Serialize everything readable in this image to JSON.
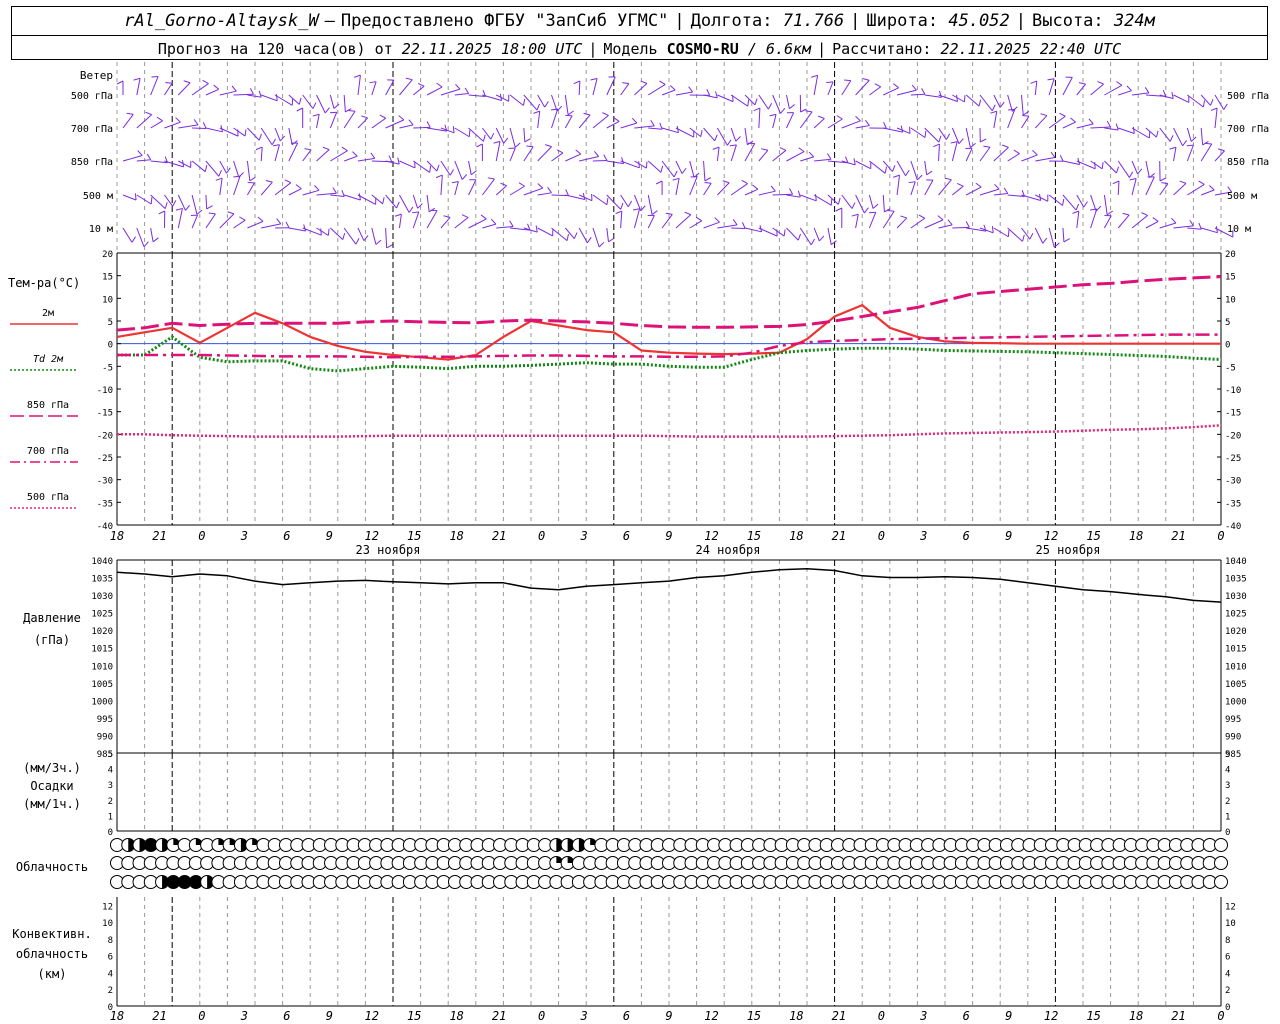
{
  "header": {
    "station": "rAl_Gorno-Altaysk_W",
    "dash": "—",
    "provided_by": "Предоставлено ФГБУ \"ЗапСиб УГМС\"",
    "lon_label": "Долгота:",
    "lon_value": "71.766",
    "lat_label": "Широта:",
    "lat_value": "45.052",
    "alt_label": "Высота:",
    "alt_value": "324м",
    "forecast_text": "Прогноз на 120 часа(ов) от",
    "forecast_time": "22.11.2025 18:00 UTC",
    "model_label": "Модель",
    "model_name": "COSMO-RU",
    "model_res": "/ 6.6км",
    "calc_label": "Рассчитано:",
    "calc_time": "22.11.2025 22:40 UTC"
  },
  "wind_panel": {
    "title": "Ветер",
    "levels": [
      "500 гПа",
      "700 гПа",
      "850 гПа",
      "500 м",
      "10  м"
    ]
  },
  "temp_panel": {
    "title": "Тем-ра(°C)",
    "legend": [
      {
        "label": "2м",
        "color": "#ee3333",
        "dash": "solid"
      },
      {
        "label": "Td  2м",
        "color": "#118811",
        "dash": "dotted"
      },
      {
        "label": "850 гПа",
        "color": "#dd1177",
        "dash": "longdash"
      },
      {
        "label": "700 гПа",
        "color": "#dd1177",
        "dash": "dashdot"
      },
      {
        "label": "500 гПа",
        "color": "#ee2277",
        "dash": "dotted"
      }
    ],
    "y_ticks": [
      "20",
      "15",
      "10",
      "5",
      "0",
      "-5",
      "-10",
      "-15",
      "-20",
      "-25",
      "-30",
      "-35",
      "-40"
    ]
  },
  "pressure_panel": {
    "title1": "Давление",
    "title2": "(гПа)",
    "y_ticks": [
      "1040",
      "1035",
      "1030",
      "1025",
      "1020",
      "1015",
      "1010",
      "1005",
      "1000",
      "995",
      "990",
      "985"
    ]
  },
  "precip_panel": {
    "title1": "(мм/3ч.)",
    "title2": "Осадки",
    "title3": "(мм/1ч.)",
    "y_ticks": [
      "5",
      "4",
      "3",
      "2",
      "1",
      "0"
    ]
  },
  "cloud_panel": {
    "title": "Облачность",
    "rows": [
      "ohhfhqoqoqqhqoooooooooooooooooooooooooohhhqoooooooooooooooooooooooooooooooooooooooooooooooooooooooo",
      "oooooooooooooooooooooooooooooooooooooooqqoooooooooooooooooooooooooooooooooooooooooooooooooooooooooo",
      "oooohfffhoooooooooooooooooooooooooooooooooooooooooooooooooooooooooooooooooooooooooooooooooooooooooo"
    ]
  },
  "convective_panel": {
    "title1": "Конвективн.",
    "title2": "облачность",
    "title3": "(км)",
    "y_ticks": [
      "12",
      "10",
      "8",
      "6",
      "4",
      "2",
      "0"
    ]
  },
  "x_axis": {
    "hour_labels": [
      "18",
      "21",
      "0",
      "3",
      "6",
      "9",
      "12",
      "15",
      "18",
      "21",
      "0",
      "3",
      "6",
      "9",
      "12",
      "15",
      "18",
      "21",
      "0",
      "3",
      "6",
      "9",
      "12",
      "15",
      "18",
      "21",
      "0"
    ],
    "date_labels": [
      "23 ноября",
      "24 ноября",
      "25 ноября"
    ]
  },
  "colors": {
    "wind": "#7a2be0",
    "t2m": "#ee3333",
    "td2m": "#118811",
    "t850": "#dd1177",
    "t700": "#dd1177",
    "t500": "#ee2277",
    "pressure": "#000000",
    "grid": "#999999"
  },
  "chart_data": {
    "type": "line",
    "x_hours_from_start": [
      0,
      3,
      6,
      9,
      12,
      15,
      18,
      21,
      24,
      27,
      30,
      33,
      36,
      39,
      42,
      45,
      48,
      51,
      54,
      57,
      60,
      63,
      66,
      69,
      72,
      75,
      78,
      81,
      84,
      87,
      90,
      93,
      96,
      99,
      102,
      105,
      108,
      111,
      114,
      117,
      120
    ],
    "x_start": "22.11.2025 18:00 UTC",
    "series": [
      {
        "name": "2м",
        "values": [
          1.5,
          2.5,
          3.5,
          0.2,
          3.5,
          6.8,
          4.5,
          1.5,
          -0.5,
          -1.8,
          -2.5,
          -3.0,
          -3.5,
          -2.5,
          1.5,
          5.0,
          4.0,
          3.0,
          2.5,
          -1.5,
          -2.0,
          -2.2,
          -2.3,
          -2.2,
          -2.0,
          1.0,
          6.0,
          8.5,
          3.5,
          1.5,
          0.5,
          0.2,
          0.1,
          0.0,
          0.0,
          0.0,
          0.0,
          0.0,
          0.0,
          0.0,
          0.0
        ]
      },
      {
        "name": "Td  2м",
        "values": [
          -2.5,
          -2.5,
          1.5,
          -3.0,
          -4.0,
          -3.8,
          -3.8,
          -5.5,
          -6.0,
          -5.5,
          -5.0,
          -5.2,
          -5.5,
          -5.0,
          -5.0,
          -4.8,
          -4.5,
          -4.2,
          -4.5,
          -4.5,
          -5.0,
          -5.2,
          -5.2,
          -3.5,
          -2.0,
          -1.5,
          -1.2,
          -1.0,
          -1.0,
          -1.2,
          -1.5,
          -1.6,
          -1.7,
          -1.8,
          -2.0,
          -2.2,
          -2.4,
          -2.6,
          -2.8,
          -3.2,
          -3.5
        ]
      },
      {
        "name": "850 гПа",
        "values": [
          3.0,
          3.5,
          4.5,
          4.0,
          4.3,
          4.5,
          4.5,
          4.5,
          4.5,
          4.8,
          5.0,
          4.8,
          4.7,
          4.6,
          5.0,
          5.2,
          5.0,
          4.8,
          4.5,
          4.0,
          3.7,
          3.6,
          3.6,
          3.7,
          3.8,
          4.2,
          5.0,
          6.0,
          7.0,
          8.0,
          9.5,
          11.0,
          11.5,
          12.0,
          12.5,
          13.0,
          13.3,
          13.8,
          14.2,
          14.5,
          14.8
        ]
      },
      {
        "name": "700 гПа",
        "values": [
          -2.5,
          -2.5,
          -2.5,
          -2.5,
          -2.6,
          -2.7,
          -2.8,
          -2.8,
          -2.8,
          -2.9,
          -3.0,
          -2.9,
          -2.9,
          -2.8,
          -2.7,
          -2.6,
          -2.6,
          -2.7,
          -2.8,
          -2.8,
          -2.9,
          -2.9,
          -2.8,
          -2.0,
          -0.5,
          0.3,
          0.6,
          0.8,
          1.0,
          1.1,
          1.2,
          1.3,
          1.4,
          1.5,
          1.6,
          1.7,
          1.8,
          1.9,
          2.0,
          2.0,
          2.0
        ]
      },
      {
        "name": "500 гПа",
        "values": [
          -20.0,
          -20.0,
          -20.2,
          -20.3,
          -20.4,
          -20.5,
          -20.5,
          -20.5,
          -20.5,
          -20.4,
          -20.3,
          -20.3,
          -20.3,
          -20.3,
          -20.3,
          -20.3,
          -20.3,
          -20.3,
          -20.3,
          -20.3,
          -20.4,
          -20.5,
          -20.5,
          -20.5,
          -20.5,
          -20.5,
          -20.4,
          -20.3,
          -20.2,
          -20.0,
          -19.8,
          -19.7,
          -19.6,
          -19.5,
          -19.4,
          -19.2,
          -19.0,
          -18.9,
          -18.7,
          -18.4,
          -18.0
        ]
      },
      {
        "name": "Давление",
        "values": [
          1036.5,
          1036.0,
          1035.2,
          1036.0,
          1035.5,
          1034.0,
          1033.0,
          1033.5,
          1034.0,
          1034.2,
          1033.8,
          1033.5,
          1033.2,
          1033.5,
          1033.5,
          1032.0,
          1031.5,
          1032.5,
          1033.0,
          1033.5,
          1034.0,
          1035.0,
          1035.5,
          1036.5,
          1037.2,
          1037.5,
          1037.0,
          1035.5,
          1035.0,
          1035.0,
          1035.2,
          1035.0,
          1034.5,
          1033.5,
          1032.5,
          1031.5,
          1031.0,
          1030.2,
          1029.5,
          1028.5,
          1028.0
        ]
      }
    ],
    "ylim_temp": [
      -40,
      20
    ],
    "ylim_pressure": [
      985,
      1040
    ],
    "ylim_precip": [
      0,
      5
    ],
    "ylim_conv": [
      0,
      13
    ],
    "grid": true
  }
}
